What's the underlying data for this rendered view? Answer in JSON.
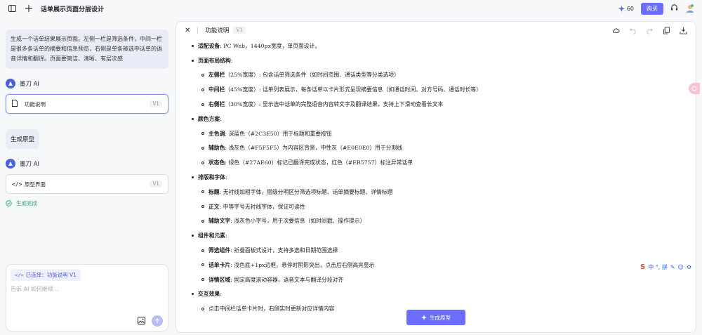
{
  "topbar": {
    "title": "话单展示页面分层设计",
    "credits": "60",
    "buy_label": "购买"
  },
  "chat": {
    "user_message": "生成一个话单结果展示页面。左侧一栏是筛选条件，中间一栏是很多条话单的摘要和信息预览，右侧是单条被选中话单的语音详情和翻译。页面要简洁、清晰、有层次感",
    "ai_name": "墨刀 AI",
    "card1": {
      "label": "功能说明",
      "version": "V1"
    },
    "gen_proto_message": "生成原型",
    "ai_name2": "墨刀 AI",
    "card2": {
      "label": "原型界面",
      "version": "V1"
    },
    "done_text": "生成完成",
    "selected_tag": "已选择：功能说明 V1",
    "input_placeholder": "告诉 AI 如何继续…"
  },
  "doc": {
    "title": "功能说明",
    "version": "V1",
    "lines": [
      {
        "lvl": 1,
        "k": "适配设备",
        "t": ": PC Web，1440px宽度，单页面设计。"
      },
      {
        "lvl": 1,
        "k": "页面布局结构",
        "t": ":"
      },
      {
        "lvl": 2,
        "k": "左侧栏",
        "t": "（25%宽度）: 包含话单筛选条件（如时间范围、通话类型等分类选项）"
      },
      {
        "lvl": 2,
        "k": "中间栏",
        "t": "（45%宽度）: 话单列表展示，每条话单以卡片形式呈现摘要信息（如通话时间、对方号码、通话时长等）"
      },
      {
        "lvl": 2,
        "k": "右侧栏",
        "t": "（30%宽度）: 显示选中话单的完整语音内容转文字及翻译结果，支持上下滑动查看长文本"
      },
      {
        "lvl": 1,
        "k": "颜色方案",
        "t": ":"
      },
      {
        "lvl": 2,
        "k": "主色调",
        "t": ": 深蓝色（#2C3E50）用于标题和重要按钮"
      },
      {
        "lvl": 2,
        "k": "辅助色",
        "t": ": 浅灰色（#F5F5F5）为内容区背景，中性灰（#E0E0E0）用于分割线"
      },
      {
        "lvl": 2,
        "k": "状态色",
        "t": ": 绿色（#27AE60）标记已翻译完成状态，红色（#EB5757）标注异常话单"
      },
      {
        "lvl": 1,
        "k": "排版和字体",
        "t": ":"
      },
      {
        "lvl": 2,
        "k": "标题",
        "t": ": 无衬线加粗字体，层级分明区分筛选项标题、话单摘要标题、详情标题"
      },
      {
        "lvl": 2,
        "k": "正文",
        "t": ": 中等字号无衬线字体，保证可读性"
      },
      {
        "lvl": 2,
        "k": "辅助文字",
        "t": ": 浅灰色小字号，用于次要信息（如时间戳、操作提示）"
      },
      {
        "lvl": 1,
        "k": "组件和元素",
        "t": ":"
      },
      {
        "lvl": 2,
        "k": "筛选组件",
        "t": ": 折叠面板式设计，支持多选和日期范围选择"
      },
      {
        "lvl": 2,
        "k": "话单卡片",
        "t": ": 浅色底+1px边框，悬停时阴影突出，点击后右侧高亮显示"
      },
      {
        "lvl": 2,
        "k": "详情区域",
        "t": ": 固定高度滚动容器，语音文本与翻译分段对齐"
      },
      {
        "lvl": 1,
        "k": "交互效果",
        "t": ":"
      },
      {
        "lvl": 2,
        "k": "",
        "t": "点击中间栏话单卡片时，右侧实时更新对应详情内容"
      }
    ],
    "gen_button": "生成原型"
  },
  "ime": {
    "label": "中 °, 拼"
  },
  "colors": {
    "accent": "#6a6dff",
    "success": "#2aa36b"
  }
}
